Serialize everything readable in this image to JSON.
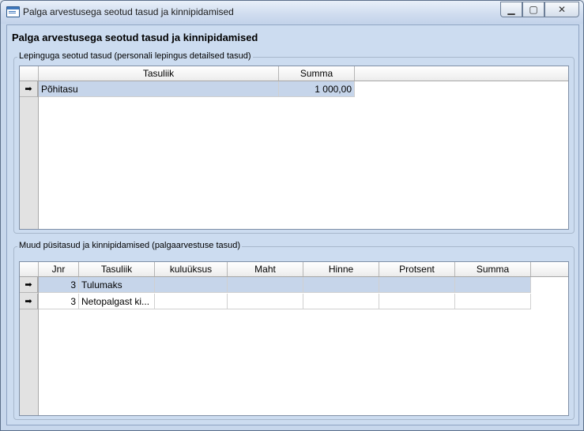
{
  "window": {
    "title": "Palga arvestusega seotud tasud ja kinnipidamised",
    "min_icon": "minimize-icon",
    "max_icon": "maximize-icon",
    "close_icon": "close-icon"
  },
  "heading": "Palga arvestusega seotud tasud ja kinnipidamised",
  "contract_group": {
    "label": "Lepinguga seotud tasud (personali lepingus detailsed tasud)",
    "columns": [
      "Tasuliik",
      "Summa"
    ],
    "rows": [
      {
        "tasuliik": "Põhitasu",
        "summa": "1 000,00"
      }
    ]
  },
  "other_group": {
    "label": "Muud püsitasud ja kinnipidamised (palgaarvestuse tasud)",
    "columns": [
      "Jnr",
      "Tasuliik",
      "kuluüksus",
      "Maht",
      "Hinne",
      "Protsent",
      "Summa"
    ],
    "rows": [
      {
        "jnr": "3",
        "tasuliik": "Tulumaks",
        "kuluuksus": "",
        "maht": "",
        "hinne": "",
        "protsent": "",
        "summa": ""
      },
      {
        "jnr": "3",
        "tasuliik": "Netopalgast ki...",
        "kuluuksus": "",
        "maht": "",
        "hinne": "",
        "protsent": "",
        "summa": ""
      }
    ]
  },
  "row_indicator_icon": "arrow-right-icon"
}
